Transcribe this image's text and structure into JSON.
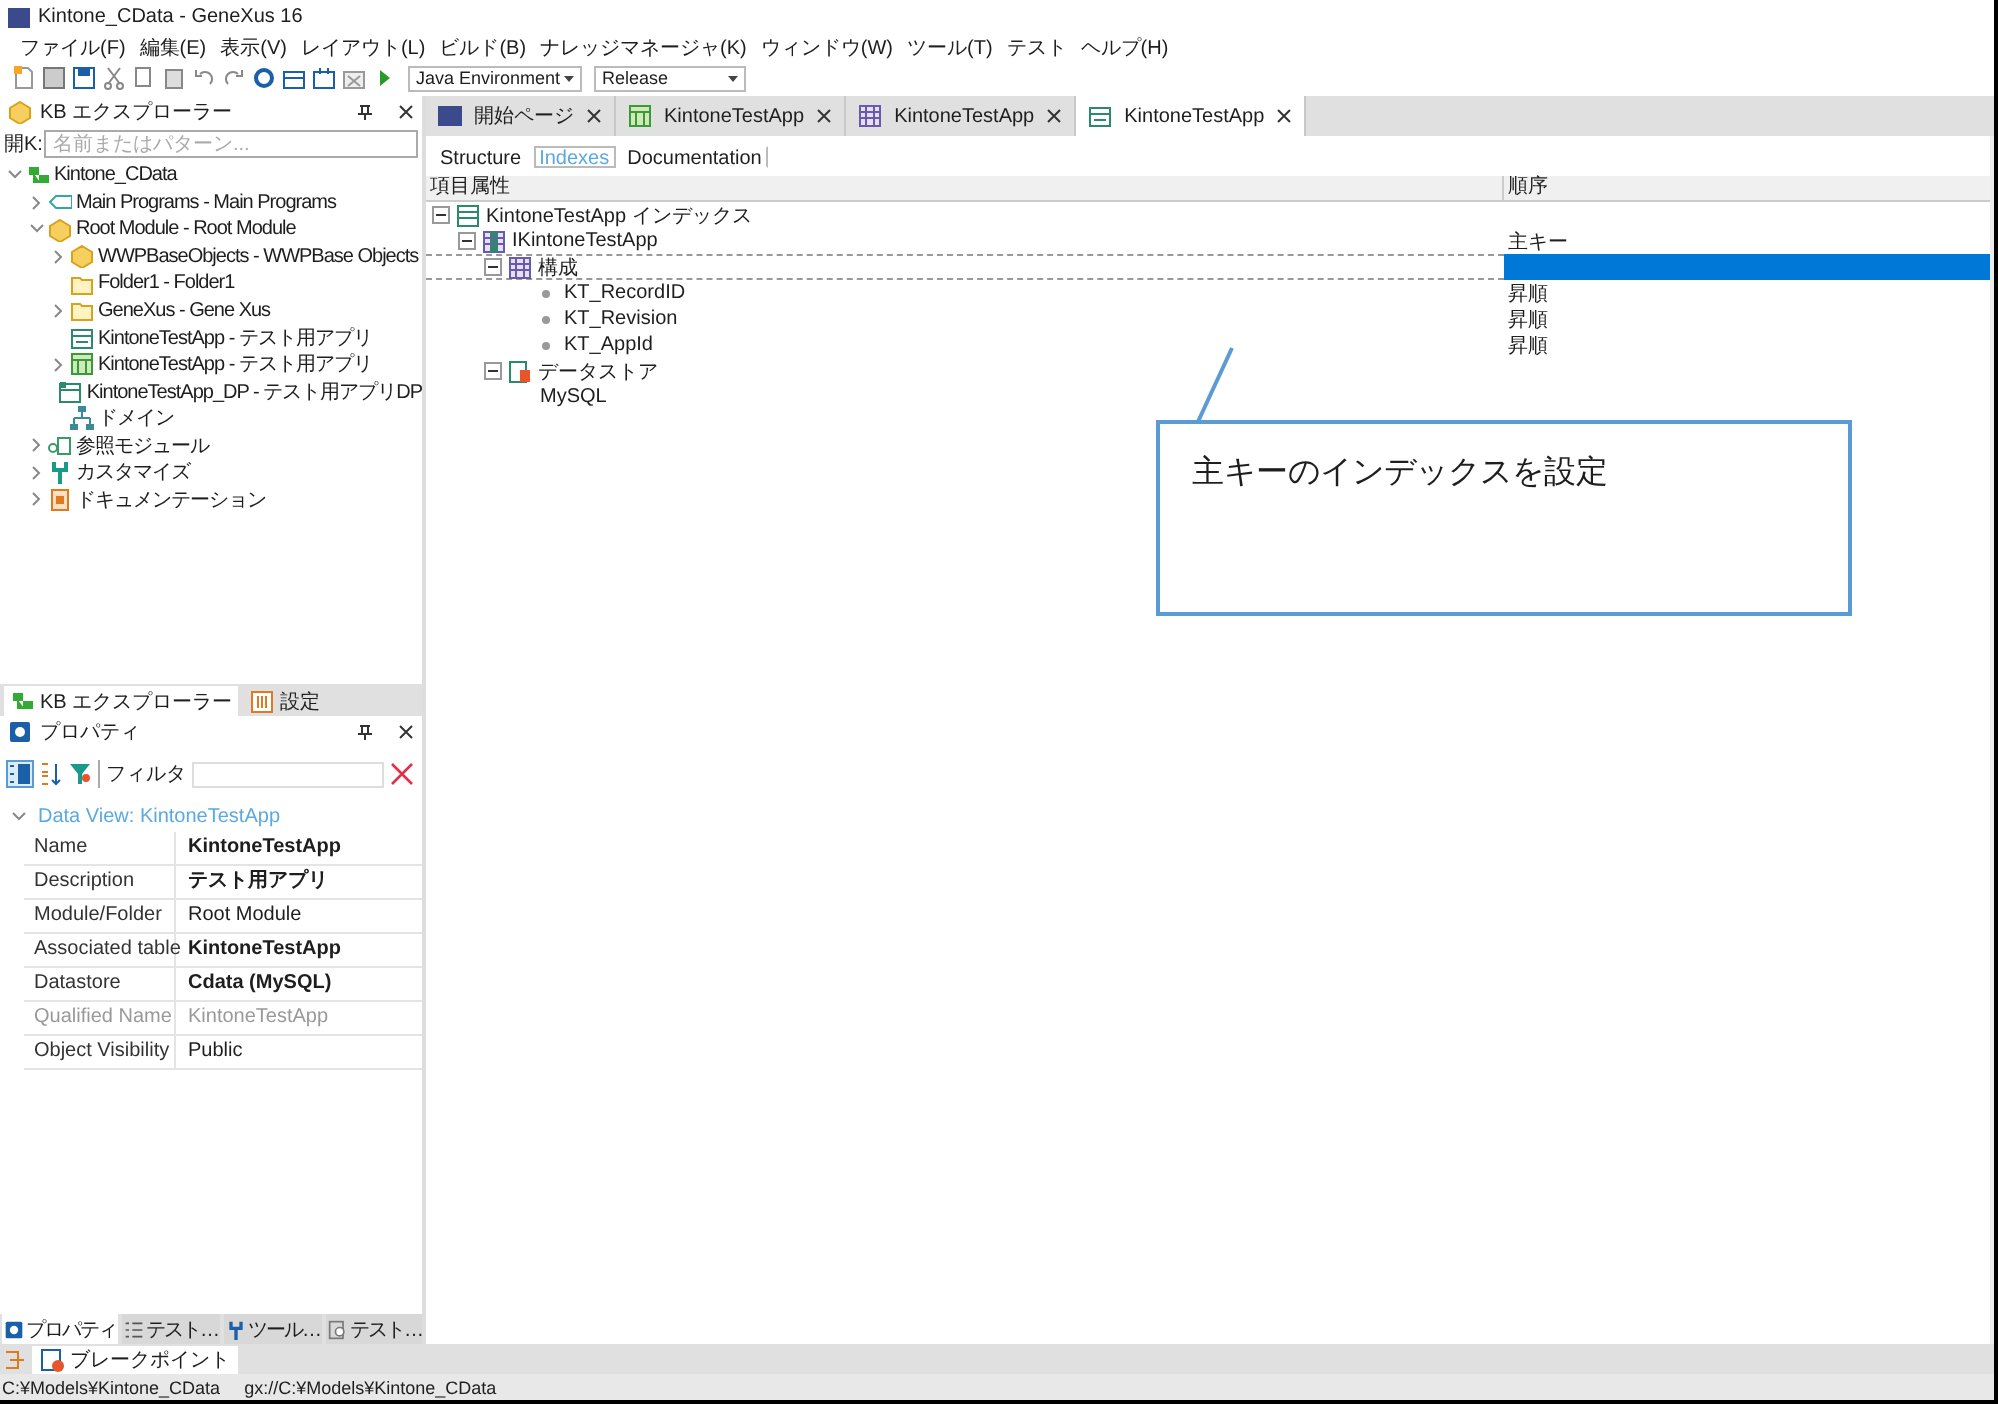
{
  "window": {
    "title": "Kintone_CData - GeneXus 16"
  },
  "menu": [
    "ファイル(F)",
    "編集(E)",
    "表示(V)",
    "レイアウト(L)",
    "ビルド(B)",
    "ナレッジマネージャ(K)",
    "ウィンドウ(W)",
    "ツール(T)",
    "テスト",
    "ヘルプ(H)"
  ],
  "toolbar": {
    "environment": "Java Environment",
    "configuration": "Release"
  },
  "kb_explorer": {
    "title": "KB エクスプローラー",
    "filter_label": "開K:",
    "search": {
      "placeholder": "名前またはパターン..."
    },
    "tree": [
      {
        "label": "Kintone_CData",
        "kind": "kb",
        "expanded": true,
        "children": [
          {
            "label": "Main Programs - Main Programs",
            "kind": "object",
            "expanded": false
          },
          {
            "label": "Root Module - Root Module",
            "kind": "module",
            "expanded": true,
            "children": [
              {
                "label": "WWPBaseObjects - WWPBase Objects",
                "kind": "module",
                "expanded": false
              },
              {
                "label": "Folder1 - Folder1",
                "kind": "folder"
              },
              {
                "label": "GeneXus - Gene Xus",
                "kind": "folder",
                "expanded": false
              },
              {
                "label": "KintoneTestApp - テスト用アプリ",
                "kind": "dataview"
              },
              {
                "label": "KintoneTestApp - テスト用アプリ",
                "kind": "transaction",
                "expanded": false
              },
              {
                "label": "KintoneTestApp_DP - テスト用アプリDP",
                "kind": "dataprovider"
              },
              {
                "label": "ドメイン",
                "kind": "domain"
              }
            ]
          },
          {
            "label": "参照モジュール",
            "kind": "references",
            "expanded": false
          },
          {
            "label": "カスタマイズ",
            "kind": "customize",
            "expanded": false
          },
          {
            "label": "ドキュメンテーション",
            "kind": "docs",
            "expanded": false
          }
        ]
      }
    ]
  },
  "panel_tabs": [
    {
      "label": "KB エクスプローラー",
      "kind": "kb",
      "selected": true
    },
    {
      "label": "設定",
      "kind": "settings",
      "selected": false
    }
  ],
  "properties": {
    "title": "プロパティ",
    "filter_label": "フィルタ",
    "section": "Data View: KintoneTestApp",
    "rows": [
      {
        "name": "Name",
        "value": "KintoneTestApp",
        "bold": true,
        "disabled": false
      },
      {
        "name": "Description",
        "value": "テスト用アプリ",
        "bold": true,
        "disabled": false
      },
      {
        "name": "Module/Folder",
        "value": "Root Module",
        "bold": false,
        "disabled": false
      },
      {
        "name": "Associated table",
        "value": "KintoneTestApp",
        "bold": true,
        "disabled": false
      },
      {
        "name": "Datastore",
        "value": "Cdata (MySQL)",
        "bold": true,
        "disabled": false
      },
      {
        "name": "Qualified Name",
        "value": "KintoneTestApp",
        "bold": false,
        "disabled": true
      },
      {
        "name": "Object Visibility",
        "value": "Public",
        "bold": false,
        "disabled": false
      }
    ]
  },
  "bottom_tabs": [
    {
      "label": "プロパティ",
      "kind": "gear",
      "selected": true
    },
    {
      "label": "テスト…",
      "kind": "list",
      "selected": false
    },
    {
      "label": "ツール…",
      "kind": "wrench",
      "selected": false
    },
    {
      "label": "テスト…",
      "kind": "search",
      "selected": false
    }
  ],
  "doc_tabs": [
    {
      "label": "開始ページ",
      "kind": "start",
      "selected": false
    },
    {
      "label": "KintoneTestApp",
      "kind": "transaction",
      "selected": false
    },
    {
      "label": "KintoneTestApp",
      "kind": "table",
      "selected": false
    },
    {
      "label": "KintoneTestApp",
      "kind": "dataview",
      "selected": true
    }
  ],
  "sub_tabs": [
    {
      "label": "Structure",
      "selected": false
    },
    {
      "label": "Indexes",
      "selected": true
    },
    {
      "label": "Documentation",
      "selected": false
    }
  ],
  "index_grid": {
    "columns": [
      "項目属性",
      "順序"
    ],
    "tree": [
      {
        "label": "KintoneTestApp インデックス",
        "kind": "indexes",
        "selected": false,
        "children": [
          {
            "label": "IKintoneTestApp",
            "kind": "index",
            "order": "主キー",
            "selected": false,
            "children": [
              {
                "label": "構成",
                "kind": "composition",
                "selected": true,
                "children": [
                  {
                    "label": "KT_RecordID",
                    "kind": "attribute",
                    "order": "昇順",
                    "selected": false
                  },
                  {
                    "label": "KT_Revision",
                    "kind": "attribute",
                    "order": "昇順",
                    "selected": false
                  },
                  {
                    "label": "KT_AppId",
                    "kind": "attribute",
                    "order": "昇順",
                    "selected": false
                  }
                ]
              },
              {
                "label": "データストア",
                "kind": "datastore",
                "selected": false,
                "children": [
                  {
                    "label": "MySQL",
                    "kind": "store",
                    "selected": false
                  }
                ]
              }
            ]
          }
        ]
      }
    ]
  },
  "annotation": {
    "text": "主キーのインデックスを設定"
  },
  "output_tabs": [
    {
      "label": "ブレークポイント",
      "selected": true
    }
  ],
  "status_bar": [
    "C:¥Models¥Kintone_CData",
    "gx://C:¥Models¥Kintone_CData"
  ]
}
